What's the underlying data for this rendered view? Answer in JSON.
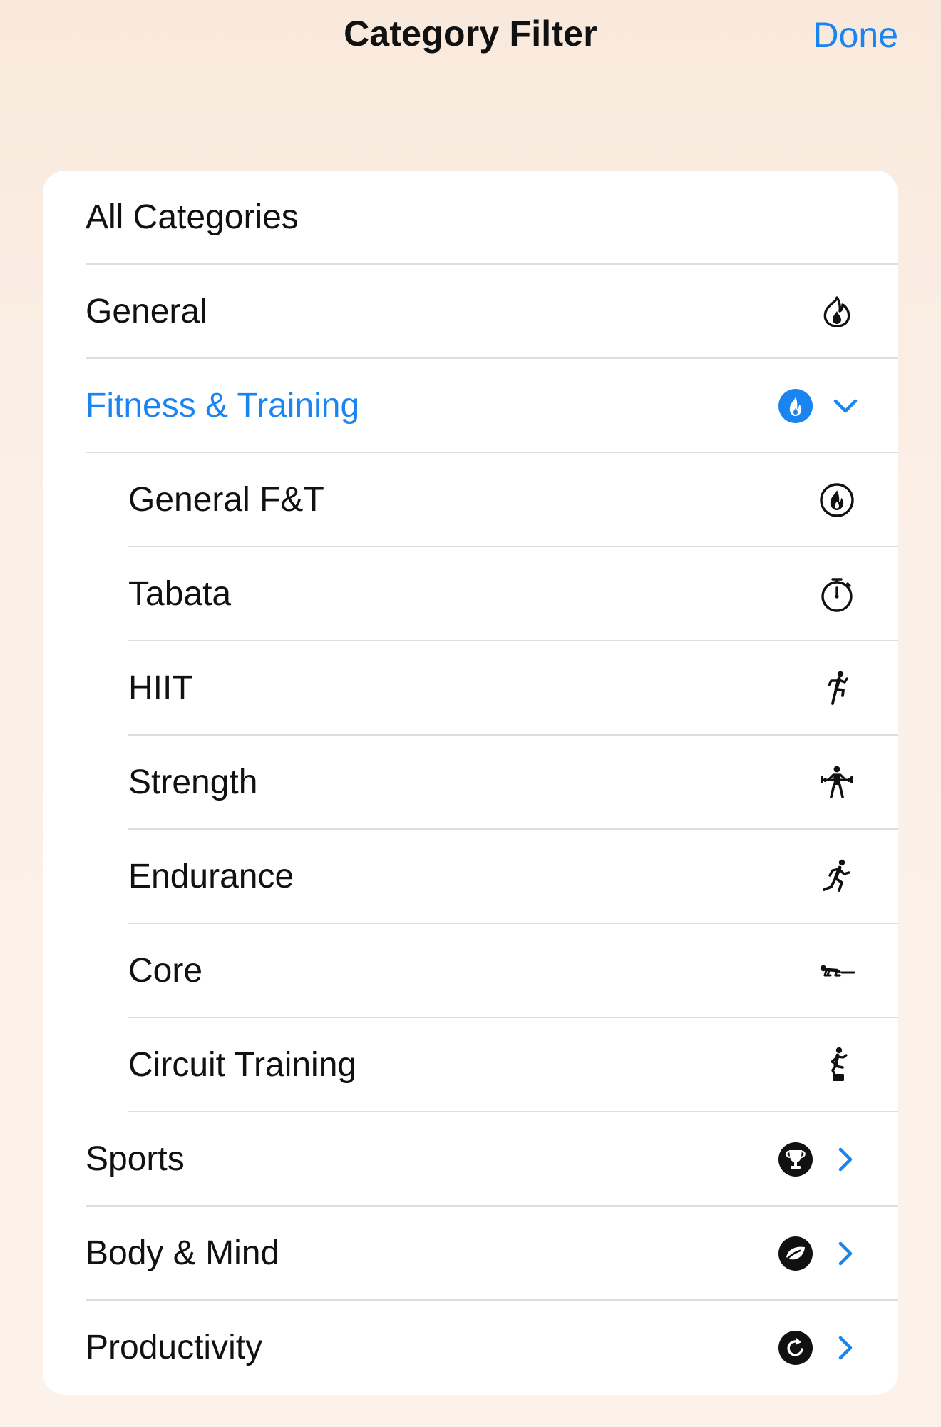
{
  "header": {
    "title": "Category Filter",
    "done_label": "Done"
  },
  "colors": {
    "accent": "#1a84f0",
    "text": "#111111",
    "separator": "#dddddd",
    "card": "#ffffff"
  },
  "categories": [
    {
      "label": "All Categories",
      "icon": "none",
      "level": 0
    },
    {
      "label": "General",
      "icon": "flame-circle-icon",
      "level": 0
    },
    {
      "label": "Fitness & Training",
      "icon": "flame-circle-filled-icon",
      "level": 0,
      "selected": true,
      "expanded": true
    },
    {
      "label": "General F&T",
      "icon": "flame-ring-icon",
      "level": 1
    },
    {
      "label": "Tabata",
      "icon": "stopwatch-icon",
      "level": 1
    },
    {
      "label": "HIIT",
      "icon": "high-knees-figure-icon",
      "level": 1
    },
    {
      "label": "Strength",
      "icon": "weightlifting-figure-icon",
      "level": 1
    },
    {
      "label": "Endurance",
      "icon": "running-figure-icon",
      "level": 1
    },
    {
      "label": "Core",
      "icon": "plank-figure-icon",
      "level": 1
    },
    {
      "label": "Circuit Training",
      "icon": "step-up-figure-icon",
      "level": 1
    },
    {
      "label": "Sports",
      "icon": "trophy-circle-icon",
      "level": 0,
      "expandable": true
    },
    {
      "label": "Body & Mind",
      "icon": "leaf-circle-icon",
      "level": 0,
      "expandable": true
    },
    {
      "label": "Productivity",
      "icon": "refresh-circle-icon",
      "level": 0,
      "expandable": true
    }
  ]
}
